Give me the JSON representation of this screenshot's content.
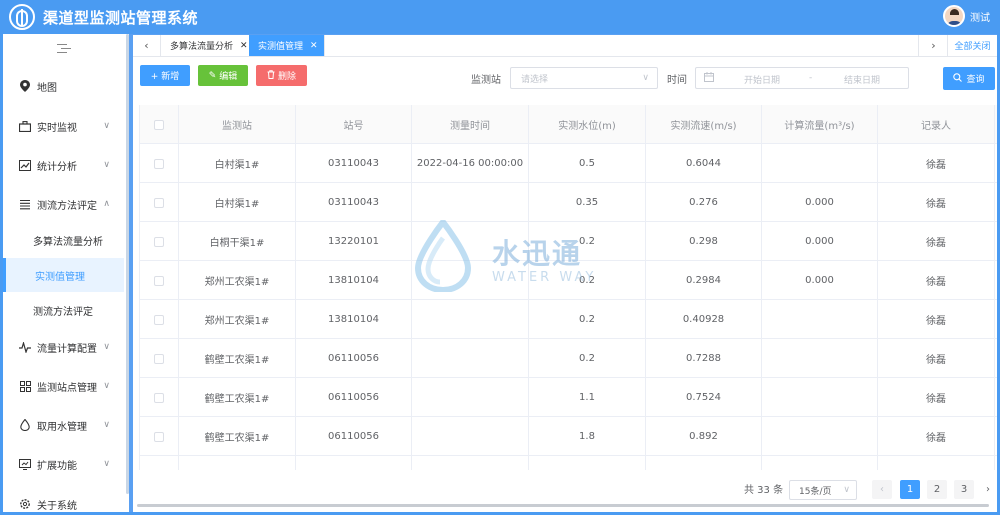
{
  "app": {
    "title": "渠道型监测站管理系统",
    "user_name": "测试"
  },
  "sidebar": {
    "items": [
      {
        "label": "地图",
        "icon": "location-icon",
        "chevron": ""
      },
      {
        "label": "实时监视",
        "icon": "briefcase-icon",
        "chevron": "∨"
      },
      {
        "label": "统计分析",
        "icon": "chart-icon",
        "chevron": "∨"
      },
      {
        "label": "测流方法评定",
        "icon": "list-icon",
        "chevron": "∧"
      },
      {
        "label": "流量计算配置",
        "icon": "pulse-icon",
        "chevron": "∨"
      },
      {
        "label": "监测站点管理",
        "icon": "grid-icon",
        "chevron": "∨"
      },
      {
        "label": "取用水管理",
        "icon": "drop-icon",
        "chevron": "∨"
      },
      {
        "label": "扩展功能",
        "icon": "screen-icon",
        "chevron": "∨"
      },
      {
        "label": "关于系统",
        "icon": "gear-icon",
        "chevron": ""
      }
    ],
    "sub_items": [
      {
        "label": "多算法流量分析",
        "active": false
      },
      {
        "label": "实测值管理",
        "active": true
      },
      {
        "label": "测流方法评定",
        "active": false
      }
    ]
  },
  "tabs": {
    "items": [
      {
        "label": "多算法流量分析",
        "active": false
      },
      {
        "label": "实测值管理",
        "active": true
      }
    ],
    "close_all": "全部关闭"
  },
  "toolbar": {
    "add_label": "+ 新增",
    "edit_label": "编辑",
    "delete_label": "删除",
    "colors": {
      "add": "#409eff",
      "edit": "#67c23a",
      "delete": "#f56c6c"
    }
  },
  "filters": {
    "station_label": "监测站",
    "station_placeholder": "请选择",
    "time_label": "时间",
    "start_placeholder": "开始日期",
    "range_separator": "-",
    "end_placeholder": "结束日期",
    "query_label": "查询"
  },
  "table": {
    "headers": [
      "监测站",
      "站号",
      "测量时间",
      "实测水位(m)",
      "实测流速(m/s)",
      "计算流量(m³/s)",
      "记录人"
    ],
    "rows": [
      [
        "白村渠1#",
        "03110043",
        "2022-04-16 00:00:00",
        "0.5",
        "0.6044",
        "",
        "徐磊"
      ],
      [
        "白村渠1#",
        "03110043",
        "",
        "0.35",
        "0.276",
        "0.000",
        "徐磊"
      ],
      [
        "白桐干渠1#",
        "13220101",
        "",
        "0.2",
        "0.298",
        "0.000",
        "徐磊"
      ],
      [
        "郑州工农渠1#",
        "13810104",
        "",
        "0.2",
        "0.2984",
        "0.000",
        "徐磊"
      ],
      [
        "郑州工农渠1#",
        "13810104",
        "",
        "0.2",
        "0.40928",
        "",
        "徐磊"
      ],
      [
        "鹤壁工农渠1#",
        "06110056",
        "",
        "0.2",
        "0.7288",
        "",
        "徐磊"
      ],
      [
        "鹤壁工农渠1#",
        "06110056",
        "",
        "1.1",
        "0.7524",
        "",
        "徐磊"
      ],
      [
        "鹤壁工农渠1#",
        "06110056",
        "",
        "1.8",
        "0.892",
        "",
        "徐磊"
      ],
      [
        "",
        "",
        "",
        "",
        "",
        "",
        ""
      ]
    ]
  },
  "pagination": {
    "total_text": "共 33 条",
    "page_size": "15条/页",
    "pages": [
      "1",
      "2",
      "3"
    ],
    "current": "1",
    "prev": "‹",
    "next": "›"
  },
  "watermark": {
    "cn": "水迅通",
    "en": "WATER WAY"
  },
  "colors": {
    "header": "#4a9bf2",
    "accent": "#409eff"
  }
}
